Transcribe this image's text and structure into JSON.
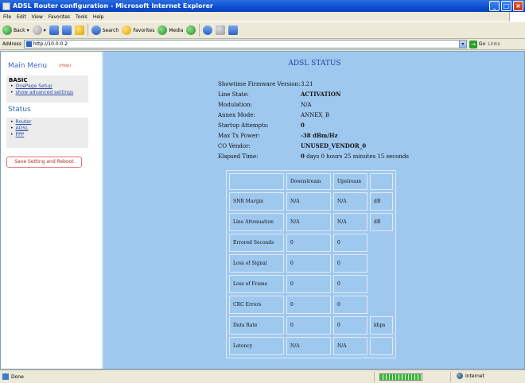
{
  "window": {
    "title": "ADSL Router configuration - Microsoft Internet Explorer"
  },
  "menu": [
    "File",
    "Edit",
    "View",
    "Favorites",
    "Tools",
    "Help"
  ],
  "toolbar": {
    "back": "Back",
    "search": "Search",
    "favorites": "Favorites",
    "media": "Media"
  },
  "address": {
    "label": "Address",
    "url": "http://10.0.0.2",
    "go": "Go",
    "links": "Links"
  },
  "sidebar": {
    "main_menu": "Main Menu",
    "help": "(Help)",
    "basic_title": "BASIC",
    "basic_links": [
      "OnePage Setup",
      "show advanced settings"
    ],
    "status_title": "Status",
    "status_links": [
      "Router",
      "ADSL",
      "PPP"
    ],
    "save_button": "Save Setting and Reboot"
  },
  "adsl": {
    "title": "ADSL STATUS",
    "info": [
      {
        "label": "Showtime Firmware Version:",
        "value": "3.21",
        "bold": false
      },
      {
        "label": "Line State:",
        "value": "ACTIVATION",
        "bold": true
      },
      {
        "label": "Modulation:",
        "value": "N/A",
        "bold": false
      },
      {
        "label": "Annex Mode:",
        "value": "ANNEX_B",
        "bold": false
      },
      {
        "label": "Startup Attempts:",
        "value": "0",
        "bold": true
      },
      {
        "label": "Max Tx Power:",
        "value": "-38 dBm/Hz",
        "bold": true
      },
      {
        "label": "CO Vendor:",
        "value": "UNUSED_VENDOR_0",
        "bold": true
      },
      {
        "label": "Elapsed Time:",
        "value_bold": "0",
        "value_rest": " days 0 hours 25 minutes 15 seconds"
      }
    ],
    "table": {
      "headers": [
        "",
        "Downstream",
        "Upstream",
        ""
      ],
      "rows": [
        [
          "SNR Margin",
          "N/A",
          "N/A",
          "dB"
        ],
        [
          "Line Attenuation",
          "N/A",
          "N/A",
          "dB"
        ],
        [
          "Errored Seconds",
          "0",
          "0",
          ""
        ],
        [
          "Loss of Signal",
          "0",
          "0",
          ""
        ],
        [
          "Loss of Frame",
          "0",
          "0",
          ""
        ],
        [
          "CRC Errors",
          "0",
          "0",
          ""
        ],
        [
          "Data Rate",
          "0",
          "0",
          "kbps"
        ],
        [
          "Latency",
          "N/A",
          "N/A",
          ""
        ]
      ]
    }
  },
  "statusbar": {
    "left": "Done",
    "zone": "Internet",
    "progress": 1.0
  }
}
